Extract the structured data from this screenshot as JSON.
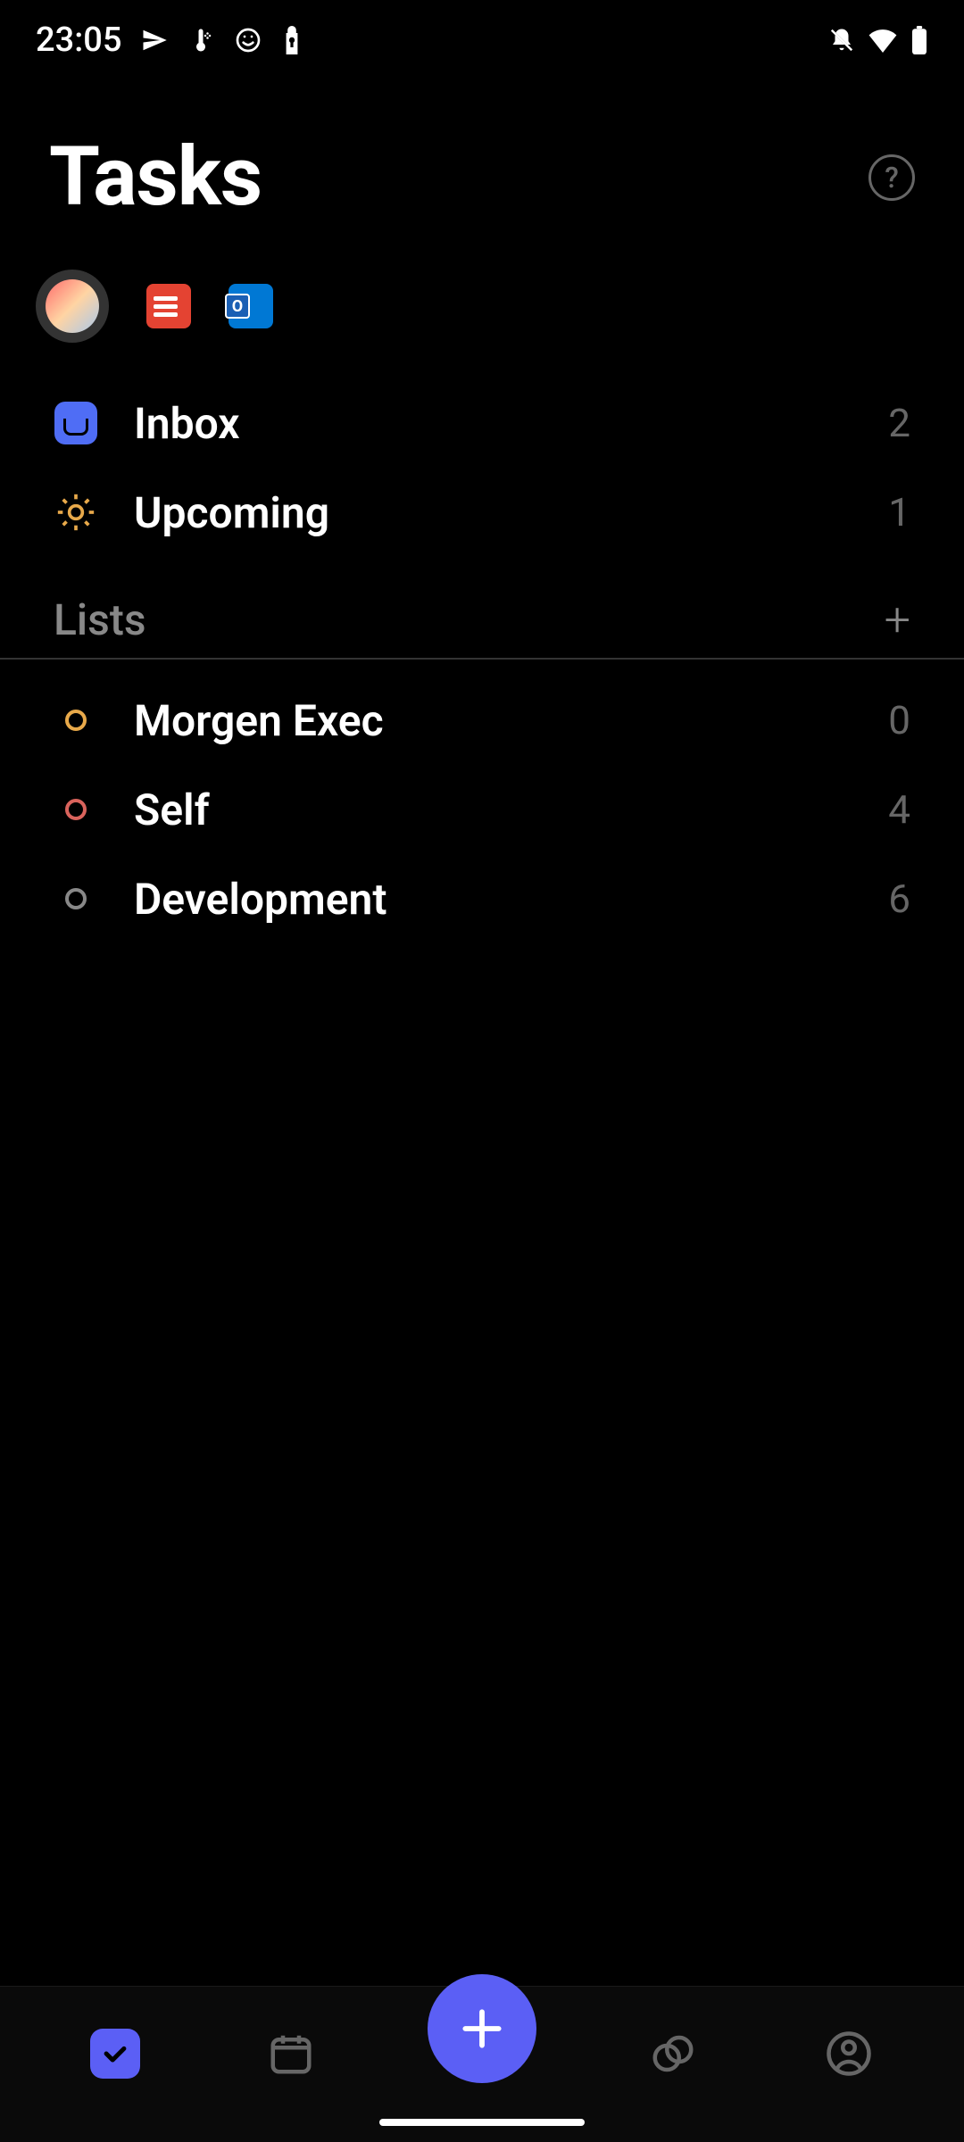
{
  "status": {
    "time": "23:05"
  },
  "header": {
    "title": "Tasks"
  },
  "smart_lists": {
    "inbox": {
      "label": "Inbox",
      "count": "2"
    },
    "upcoming": {
      "label": "Upcoming",
      "count": "1"
    }
  },
  "lists_section": {
    "title": "Lists"
  },
  "lists": [
    {
      "label": "Morgen Exec",
      "count": "0",
      "color": "#e8a94a"
    },
    {
      "label": "Self",
      "count": "4",
      "color": "#d9635c"
    },
    {
      "label": "Development",
      "count": "6",
      "color": "#888888"
    }
  ]
}
